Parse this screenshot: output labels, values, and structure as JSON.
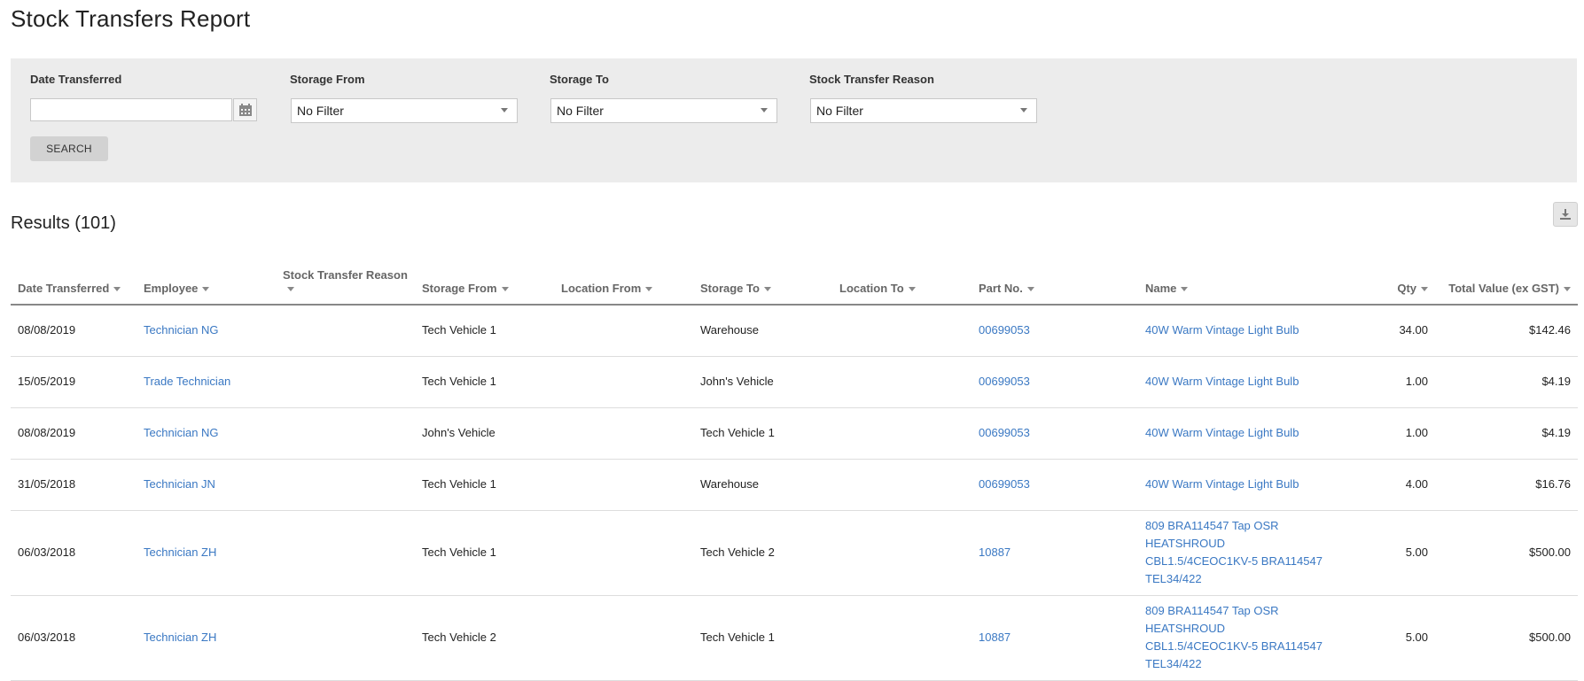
{
  "page": {
    "title": "Stock Transfers Report"
  },
  "filters": {
    "date_transferred": {
      "label": "Date Transferred",
      "value": ""
    },
    "storage_from": {
      "label": "Storage From",
      "value": "No Filter"
    },
    "storage_to": {
      "label": "Storage To",
      "value": "No Filter"
    },
    "reason": {
      "label": "Stock Transfer Reason",
      "value": "No Filter"
    },
    "search_label": "SEARCH"
  },
  "results": {
    "title": "Results (101)",
    "columns": [
      "Date Transferred",
      "Employee",
      "Stock Transfer Reason",
      "Storage From",
      "Location From",
      "Storage To",
      "Location To",
      "Part No.",
      "Name",
      "Qty",
      "Total Value (ex GST)"
    ],
    "rows": [
      {
        "date": "08/08/2019",
        "employee": "Technician NG",
        "reason": "",
        "storage_from": "Tech Vehicle 1",
        "location_from": "",
        "storage_to": "Warehouse",
        "location_to": "",
        "part_no": "00699053",
        "name": "40W Warm Vintage Light Bulb",
        "qty": "34.00",
        "total": "$142.46"
      },
      {
        "date": "15/05/2019",
        "employee": "Trade Technician",
        "reason": "",
        "storage_from": "Tech Vehicle 1",
        "location_from": "",
        "storage_to": "John's Vehicle",
        "location_to": "",
        "part_no": "00699053",
        "name": "40W Warm Vintage Light Bulb",
        "qty": "1.00",
        "total": "$4.19"
      },
      {
        "date": "08/08/2019",
        "employee": "Technician NG",
        "reason": "",
        "storage_from": "John's Vehicle",
        "location_from": "",
        "storage_to": "Tech Vehicle 1",
        "location_to": "",
        "part_no": "00699053",
        "name": "40W Warm Vintage Light Bulb",
        "qty": "1.00",
        "total": "$4.19"
      },
      {
        "date": "31/05/2018",
        "employee": "Technician JN",
        "reason": "",
        "storage_from": "Tech Vehicle 1",
        "location_from": "",
        "storage_to": "Warehouse",
        "location_to": "",
        "part_no": "00699053",
        "name": "40W Warm Vintage Light Bulb",
        "qty": "4.00",
        "total": "$16.76"
      },
      {
        "date": "06/03/2018",
        "employee": "Technician ZH",
        "reason": "",
        "storage_from": "Tech Vehicle 1",
        "location_from": "",
        "storage_to": "Tech Vehicle 2",
        "location_to": "",
        "part_no": "10887",
        "name": "809 BRA114547 Tap OSR HEATSHROUD CBL1.5/4CEOC1KV-5 BRA114547 TEL34/422",
        "qty": "5.00",
        "total": "$500.00"
      },
      {
        "date": "06/03/2018",
        "employee": "Technician ZH",
        "reason": "",
        "storage_from": "Tech Vehicle 2",
        "location_from": "",
        "storage_to": "Tech Vehicle 1",
        "location_to": "",
        "part_no": "10887",
        "name": "809 BRA114547 Tap OSR HEATSHROUD CBL1.5/4CEOC1KV-5 BRA114547 TEL34/422",
        "qty": "5.00",
        "total": "$500.00"
      }
    ]
  },
  "icons": {
    "calendar": "calendar-icon",
    "download": "download-icon"
  },
  "colors": {
    "link": "#3a78c3",
    "panel": "#ececec"
  }
}
